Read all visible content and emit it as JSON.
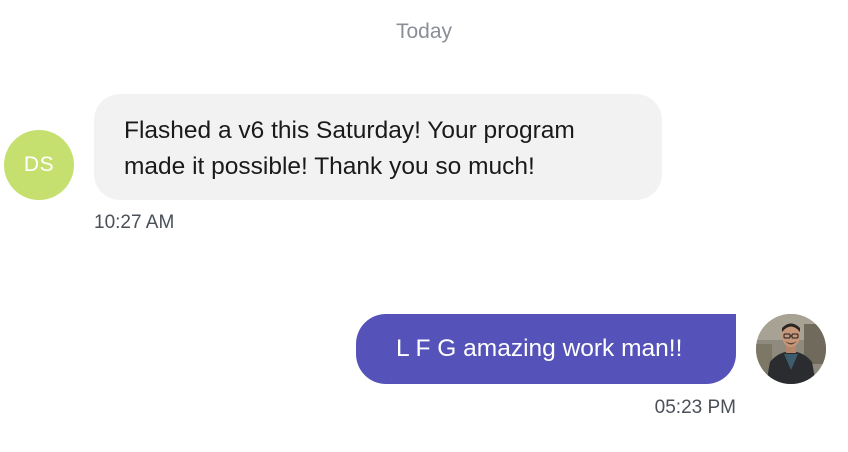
{
  "colors": {
    "incoming_avatar": "#c6e06f",
    "outgoing_bubble": "#5553b9",
    "incoming_bubble": "#f2f2f2"
  },
  "chat": {
    "date_divider": "Today",
    "messages": [
      {
        "direction": "incoming",
        "sender_initials": "DS",
        "text": "Flashed a v6 this Saturday! Your program made it possible! Thank you so much!",
        "time": "10:27 AM"
      },
      {
        "direction": "outgoing",
        "text": "L F G amazing work man!!",
        "time": "05:23 PM",
        "avatar": "user-photo-avatar"
      }
    ]
  }
}
